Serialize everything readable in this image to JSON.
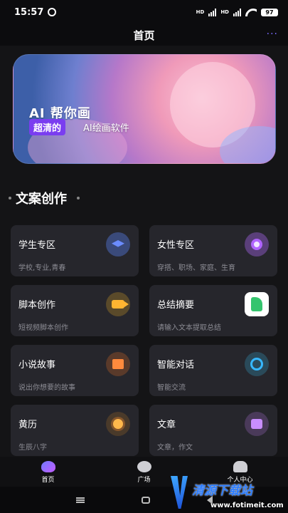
{
  "status_bar": {
    "time": "15:57",
    "signal1": "HD",
    "signal2": "HD",
    "battery": "97"
  },
  "header": {
    "title": "首页",
    "more": "···"
  },
  "banner": {
    "title": "AI 帮你画",
    "tag": "超清的",
    "subtitle": "AI绘画软件"
  },
  "section": {
    "title": "文案创作"
  },
  "cards": [
    {
      "title": "学生专区",
      "subtitle": "学校,专业,青春",
      "icon": "graduation-cap-icon"
    },
    {
      "title": "女性专区",
      "subtitle": "穿搭、职场、家庭、生育",
      "icon": "ring-icon"
    },
    {
      "title": "脚本创作",
      "subtitle": "短视频脚本创作",
      "icon": "video-camera-icon"
    },
    {
      "title": "总结摘要",
      "subtitle": "请输入文本提取总结",
      "icon": "leaf-icon"
    },
    {
      "title": "小说故事",
      "subtitle": "说出你想要的故事",
      "icon": "book-icon"
    },
    {
      "title": "智能对话",
      "subtitle": "智能交流",
      "icon": "chat-icon"
    },
    {
      "title": "黄历",
      "subtitle": "生辰八字",
      "icon": "sun-icon"
    },
    {
      "title": "文章",
      "subtitle": "文章，作文",
      "icon": "document-icon"
    }
  ],
  "tabbar": [
    {
      "label": "首页",
      "icon": "home-icon"
    },
    {
      "label": "广场",
      "icon": "palette-icon"
    },
    {
      "label": "个人中心",
      "icon": "person-icon"
    }
  ],
  "watermark": {
    "text": "清源下载站",
    "url": "www.fotimeit.com"
  },
  "colors": {
    "accent": "#7a3df0",
    "card_bg": "#26262c",
    "page_bg": "#141416"
  }
}
